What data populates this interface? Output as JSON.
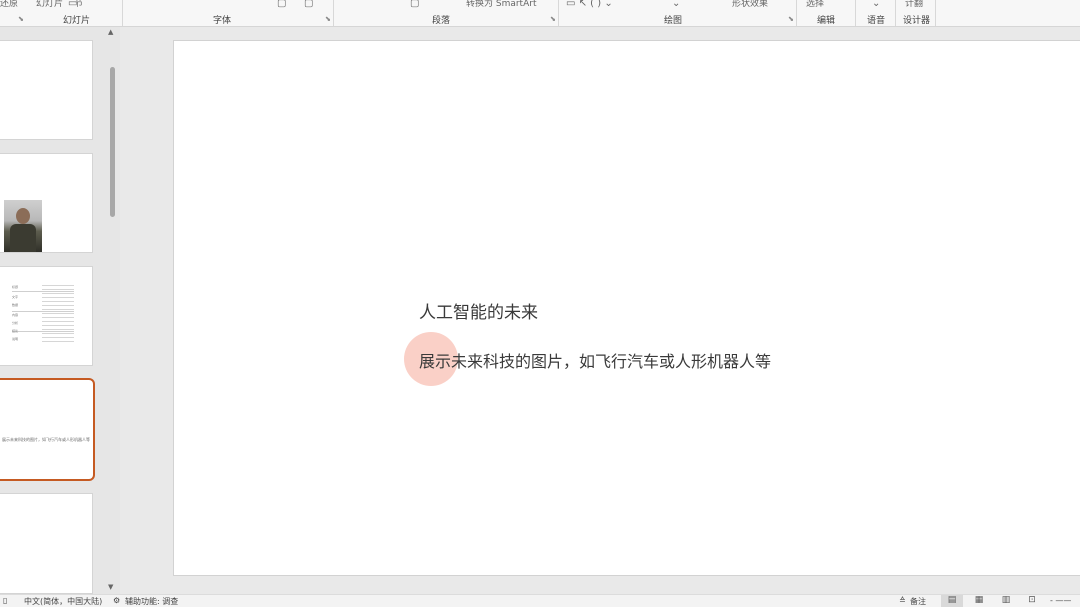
{
  "ribbon": {
    "truncated_top": {
      "slides_new": "幻灯片",
      "section": "节",
      "smartart": "转换为 SmartArt",
      "shape_effects": "形状效果",
      "select": "选择",
      "restore": "还原",
      "designer_top": "计翻"
    },
    "groups": {
      "slides": "幻灯片",
      "font": "字体",
      "paragraph": "段落",
      "drawing": "绘图",
      "editing": "编辑",
      "voice": "语音",
      "designer": "设计器"
    }
  },
  "thumbnails": {
    "table_rows": [
      "标题",
      "文字",
      "数据",
      "内容",
      "分析",
      "结论",
      "说明",
      "要点",
      "总结"
    ],
    "slide4_text": "展示未来科技的图片，如飞行汽车或人形机器人等"
  },
  "slide": {
    "title": "人工智能的未来",
    "subtitle": "展示未来科技的图片，如飞行汽车或人形机器人等"
  },
  "statusbar": {
    "language": "中文(简体，中国大陆)",
    "accessibility": "辅助功能: 调查",
    "notes": "备注"
  },
  "colors": {
    "selected_thumb_border": "#c55a22",
    "cursor_highlight": "#f49682"
  }
}
